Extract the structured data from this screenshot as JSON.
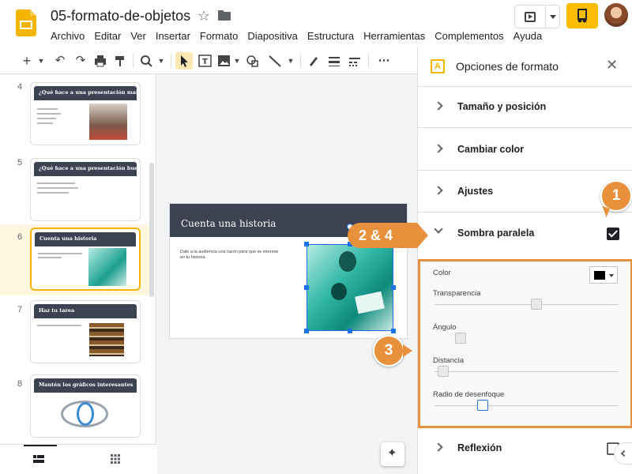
{
  "app": {
    "doc_title": "05-formato-de-objetos",
    "menu": [
      "Archivo",
      "Editar",
      "Ver",
      "Insertar",
      "Formato",
      "Diapositiva",
      "Estructura",
      "Herramientas",
      "Complementos",
      "Ayuda"
    ]
  },
  "filmstrip": {
    "slides": [
      {
        "num": "4",
        "title": "¿Qué hace a una presentación mala?"
      },
      {
        "num": "5",
        "title": "¿Qué hace a una presentación buena?"
      },
      {
        "num": "6",
        "title": "Cuenta una historia"
      },
      {
        "num": "7",
        "title": "Haz tu tarea"
      },
      {
        "num": "8",
        "title": "Mantén los gráficos interesantes"
      }
    ]
  },
  "slide": {
    "title": "Cuenta una historia",
    "body": "Dale a la audiencia una razón para que se interese en tu historia."
  },
  "panel": {
    "title": "Opciones de formato",
    "sections": {
      "size": "Tamaño y posición",
      "color": "Cambiar color",
      "adjust": "Ajustes",
      "shadow": "Sombra paralela",
      "reflection": "Reflexión"
    },
    "shadow_options": {
      "color_label": "Color",
      "transparency_label": "Transparencia",
      "angle_label": "Ángulo",
      "distance_label": "Distancia",
      "blur_label": "Radio de desenfoque",
      "shadow_color": "#000000"
    }
  },
  "callouts": {
    "one": "1",
    "two_four": "2 & 4",
    "three": "3"
  },
  "colors": {
    "accent": "#e8913d",
    "slide_header": "#3c4251",
    "selection": "#1a73e8",
    "share": "#fbbc04"
  }
}
